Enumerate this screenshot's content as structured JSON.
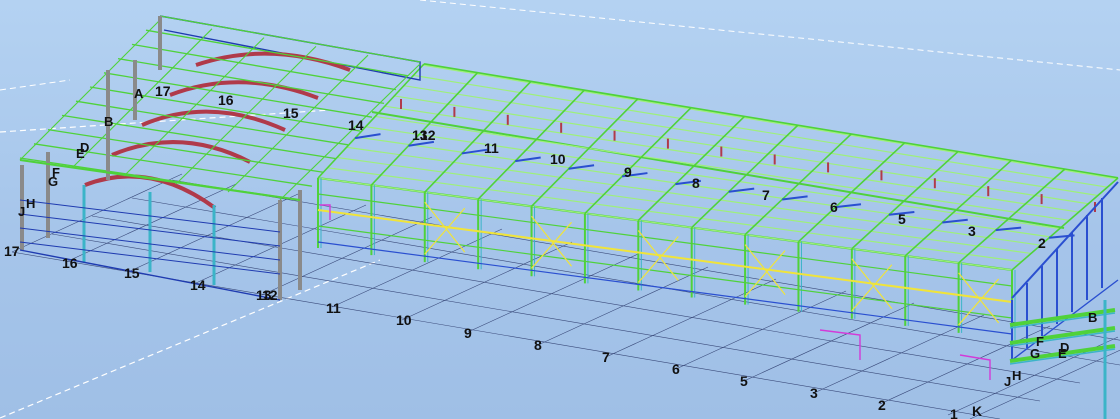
{
  "model_view": {
    "background_color": "#a9c8ec",
    "grid_labels": {
      "ground_front": [
        "17",
        "16",
        "15",
        "14",
        "13",
        "12",
        "11",
        "10",
        "9",
        "8",
        "7",
        "6",
        "5",
        "3",
        "2",
        "1",
        "K"
      ],
      "roof": [
        "17",
        "16",
        "15",
        "14",
        "13",
        "12",
        "11",
        "10",
        "9",
        "8",
        "7",
        "6",
        "5",
        "3",
        "2"
      ],
      "left_end": [
        "A",
        "B",
        "D",
        "E",
        "F",
        "G",
        "J",
        "H"
      ],
      "right_end": [
        "B",
        "D",
        "E",
        "F",
        "G",
        "J",
        "H"
      ]
    },
    "colors": {
      "purlin_green": "#4fd23a",
      "light_green": "#9ef07a",
      "column_cyan": "#3bb4c8",
      "rafter_red": "#b03a4a",
      "bracing_yellow": "#f0e43a",
      "edge_blue": "#1f3bb0",
      "gridline": "#3a4a7a",
      "steel_grey": "#8a8a8a",
      "magenta": "#d33ad8"
    }
  }
}
